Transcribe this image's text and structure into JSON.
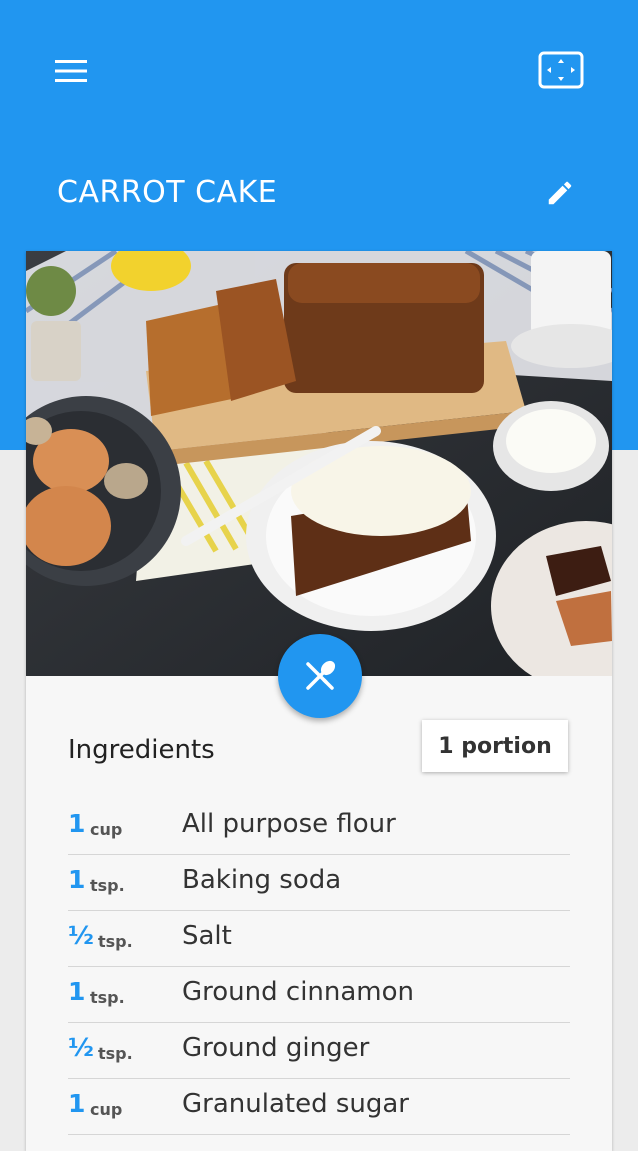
{
  "app": {
    "title": "CARROT CAKE",
    "accent_color": "#2196f0"
  },
  "toolbar": {
    "menu_icon": "hamburger-menu-icon",
    "expand_icon": "fullscreen-icon",
    "edit_icon": "pencil-icon"
  },
  "recipe": {
    "image_alt": "carrot-cake-photo",
    "fab_icon": "utensils-icon"
  },
  "ingredients": {
    "heading": "Ingredients",
    "portion_label": "1 portion",
    "items": [
      {
        "qty": "1",
        "unit": "cup",
        "name": "All purpose flour"
      },
      {
        "qty": "1",
        "unit": "tsp.",
        "name": "Baking soda"
      },
      {
        "qty": "½",
        "unit": "tsp.",
        "name": "Salt"
      },
      {
        "qty": "1",
        "unit": "tsp.",
        "name": "Ground cinnamon"
      },
      {
        "qty": "½",
        "unit": "tsp.",
        "name": "Ground ginger"
      },
      {
        "qty": "1",
        "unit": "cup",
        "name": "Granulated sugar"
      }
    ]
  }
}
